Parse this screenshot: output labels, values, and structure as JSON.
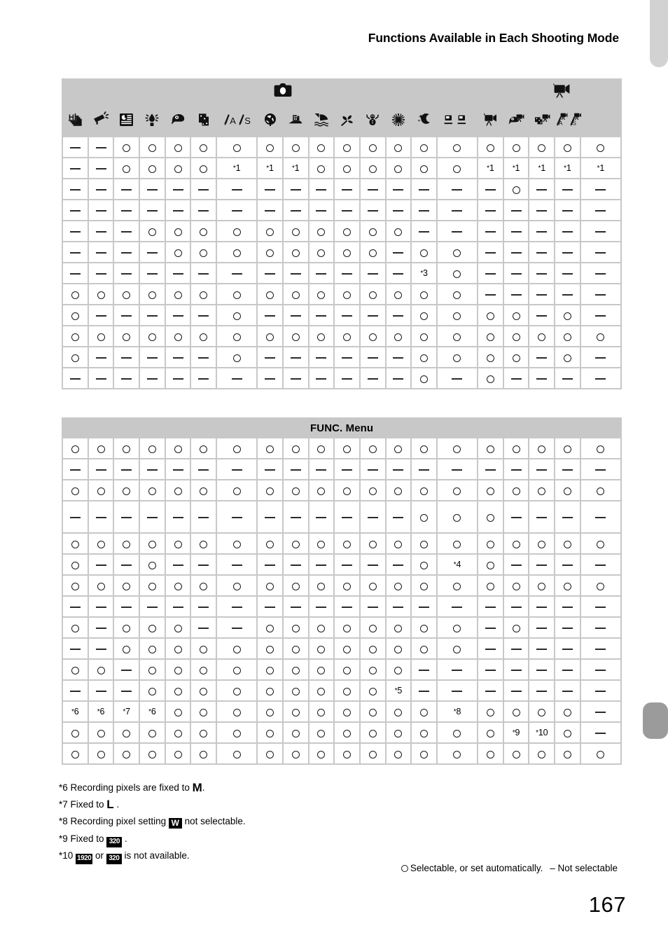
{
  "page": {
    "title": "Functions Available in Each Shooting Mode",
    "number": "167"
  },
  "colors": {
    "grid": "#c8c8c8",
    "header_bg": "#c8c8c8",
    "cell_bg": "#ffffff",
    "ink": "#1a1a1a",
    "tab_light": "#d2d2d2",
    "tab_current": "#9b9b9b"
  },
  "groups": [
    {
      "label": "still-camera-icon",
      "icon": "camera",
      "span": 16
    },
    {
      "label": "movie-camera-icon",
      "icon": "movie",
      "span": 4
    }
  ],
  "mode_columns": [
    {
      "icon": "high-speed-burst",
      "wide": false
    },
    {
      "icon": "best-image-selection",
      "wide": false
    },
    {
      "icon": "handheld-nightscene",
      "wide": false
    },
    {
      "icon": "low-light",
      "wide": false
    },
    {
      "icon": "fish-eye-effect",
      "wide": false
    },
    {
      "icon": "miniature-effect",
      "wide": false
    },
    {
      "icon": "creative-filters-as",
      "wide": true
    },
    {
      "icon": "monochrome",
      "wide": false
    },
    {
      "icon": "poster-effect",
      "wide": false
    },
    {
      "icon": "beach",
      "wide": false
    },
    {
      "icon": "foliage",
      "wide": false
    },
    {
      "icon": "snow",
      "wide": false
    },
    {
      "icon": "fireworks",
      "wide": false
    },
    {
      "icon": "long-shutter",
      "wide": false
    },
    {
      "icon": "stitch-assist",
      "wide": true
    },
    {
      "icon": "movie-standard",
      "wide": false
    },
    {
      "icon": "movie-fish-eye",
      "wide": false
    },
    {
      "icon": "movie-miniature",
      "wide": false
    },
    {
      "icon": "movie-creative-as",
      "wide": true
    }
  ],
  "section_label": "FUNC. Menu",
  "marks": {
    "available": "O",
    "unavailable": "–"
  },
  "table_top": {
    "rows": [
      {
        "cells": [
          "-",
          "-",
          "o",
          "o",
          "o",
          "o",
          "o",
          "o",
          "o",
          "o",
          "o",
          "o",
          "o",
          "o",
          "o",
          "o",
          "o",
          "o",
          "o",
          "o"
        ]
      },
      {
        "cells": [
          "-",
          "-",
          "o",
          "o",
          "o",
          "o",
          "*1",
          "*1",
          "*1",
          "o",
          "o",
          "o",
          "o",
          "o",
          "o",
          "*1",
          "*1",
          "*1",
          "*1",
          "*1"
        ]
      },
      {
        "cells": [
          "-",
          "-",
          "-",
          "-",
          "-",
          "-",
          "-",
          "-",
          "-",
          "-",
          "-",
          "-",
          "-",
          "-",
          "-",
          "-",
          "o",
          "-",
          "-",
          "-"
        ]
      },
      {
        "cells": [
          "-",
          "-",
          "-",
          "-",
          "-",
          "-",
          "-",
          "-",
          "-",
          "-",
          "-",
          "-",
          "-",
          "-",
          "-",
          "-",
          "-",
          "-",
          "-",
          "-"
        ]
      },
      {
        "cells": [
          "-",
          "-",
          "-",
          "o",
          "o",
          "o",
          "o",
          "o",
          "o",
          "o",
          "o",
          "o",
          "o",
          "-",
          "-",
          "-",
          "-",
          "-",
          "-",
          "-"
        ]
      },
      {
        "cells": [
          "-",
          "-",
          "-",
          "-",
          "o",
          "o",
          "o",
          "o",
          "o",
          "o",
          "o",
          "o",
          "-",
          "o",
          "o",
          "-",
          "-",
          "-",
          "-",
          "-"
        ]
      },
      {
        "cells": [
          "-",
          "-",
          "-",
          "-",
          "-",
          "-",
          "-",
          "-",
          "-",
          "-",
          "-",
          "-",
          "-",
          "*3",
          "o",
          "-",
          "-",
          "-",
          "-",
          "-"
        ]
      },
      {
        "cells": [
          "o",
          "o",
          "o",
          "o",
          "o",
          "o",
          "o",
          "o",
          "o",
          "o",
          "o",
          "o",
          "o",
          "o",
          "o",
          "-",
          "-",
          "-",
          "-",
          "-"
        ]
      },
      {
        "cells": [
          "o",
          "-",
          "-",
          "-",
          "-",
          "-",
          "o",
          "-",
          "-",
          "-",
          "-",
          "-",
          "-",
          "o",
          "o",
          "o",
          "o",
          "-",
          "o"
        ]
      },
      {
        "cells": [
          "o",
          "o",
          "o",
          "o",
          "o",
          "o",
          "o",
          "o",
          "o",
          "o",
          "o",
          "o",
          "o",
          "o",
          "o",
          "o",
          "o",
          "o",
          "o",
          "o"
        ]
      },
      {
        "cells": [
          "o",
          "-",
          "-",
          "-",
          "-",
          "-",
          "o",
          "-",
          "-",
          "-",
          "-",
          "-",
          "-",
          "o",
          "o",
          "o",
          "o",
          "-",
          "o"
        ]
      },
      {
        "cells": [
          "-",
          "-",
          "-",
          "-",
          "-",
          "-",
          "-",
          "-",
          "-",
          "-",
          "-",
          "-",
          "-",
          "o",
          "-",
          "o",
          "-",
          "-",
          "-",
          "-"
        ]
      }
    ]
  },
  "table_func": {
    "rows": [
      {
        "tall": false,
        "cells": [
          "o",
          "o",
          "o",
          "o",
          "o",
          "o",
          "o",
          "o",
          "o",
          "o",
          "o",
          "o",
          "o",
          "o",
          "o",
          "o",
          "o",
          "o",
          "o",
          "o"
        ]
      },
      {
        "tall": false,
        "cells": [
          "-",
          "-",
          "-",
          "-",
          "-",
          "-",
          "-",
          "-",
          "-",
          "-",
          "-",
          "-",
          "-",
          "-",
          "-",
          "-",
          "-",
          "-",
          "-",
          "-"
        ]
      },
      {
        "tall": false,
        "cells": [
          "o",
          "o",
          "o",
          "o",
          "o",
          "o",
          "o",
          "o",
          "o",
          "o",
          "o",
          "o",
          "o",
          "o",
          "o",
          "o",
          "o",
          "o",
          "o",
          "o"
        ]
      },
      {
        "tall": true,
        "cells": [
          "-",
          "-",
          "-",
          "-",
          "-",
          "-",
          "-",
          "-",
          "-",
          "-",
          "-",
          "-",
          "-",
          "o",
          "o",
          "o",
          "-",
          "-",
          "-",
          "-"
        ]
      },
      {
        "tall": false,
        "cells": [
          "o",
          "o",
          "o",
          "o",
          "o",
          "o",
          "o",
          "o",
          "o",
          "o",
          "o",
          "o",
          "o",
          "o",
          "o",
          "o",
          "o",
          "o",
          "o",
          "o"
        ]
      },
      {
        "tall": false,
        "cells": [
          "o",
          "-",
          "-",
          "o",
          "-",
          "-",
          "-",
          "-",
          "-",
          "-",
          "-",
          "-",
          "-",
          "o",
          "*4",
          "o",
          "-",
          "-",
          "-",
          "-"
        ]
      },
      {
        "tall": false,
        "cells": [
          "o",
          "o",
          "o",
          "o",
          "o",
          "o",
          "o",
          "o",
          "o",
          "o",
          "o",
          "o",
          "o",
          "o",
          "o",
          "o",
          "o",
          "o",
          "o",
          "o"
        ]
      },
      {
        "tall": false,
        "cells": [
          "-",
          "-",
          "-",
          "-",
          "-",
          "-",
          "-",
          "-",
          "-",
          "-",
          "-",
          "-",
          "-",
          "-",
          "-",
          "-",
          "-",
          "-",
          "-",
          "-"
        ]
      },
      {
        "tall": false,
        "cells": [
          "o",
          "-",
          "o",
          "o",
          "o",
          "-",
          "-",
          "o",
          "o",
          "o",
          "o",
          "o",
          "o",
          "o",
          "o",
          "-",
          "o",
          "-",
          "-",
          "-",
          "-"
        ]
      },
      {
        "tall": false,
        "cells": [
          "-",
          "-",
          "o",
          "o",
          "o",
          "o",
          "o",
          "o",
          "o",
          "o",
          "o",
          "o",
          "o",
          "o",
          "o",
          "-",
          "-",
          "-",
          "-",
          "-"
        ]
      },
      {
        "tall": false,
        "cells": [
          "o",
          "o",
          "-",
          "o",
          "o",
          "o",
          "o",
          "o",
          "o",
          "o",
          "o",
          "o",
          "o",
          "-",
          "-",
          "-",
          "-",
          "-",
          "-",
          "-"
        ]
      },
      {
        "tall": false,
        "cells": [
          "-",
          "-",
          "-",
          "o",
          "o",
          "o",
          "o",
          "o",
          "o",
          "o",
          "o",
          "o",
          "*5",
          "-",
          "-",
          "-",
          "-",
          "-",
          "-",
          "-"
        ]
      },
      {
        "tall": false,
        "cells": [
          "*6",
          "*6",
          "*7",
          "*6",
          "o",
          "o",
          "o",
          "o",
          "o",
          "o",
          "o",
          "o",
          "o",
          "o",
          "*8",
          "o",
          "o",
          "o",
          "o"
        ]
      },
      {
        "tall": false,
        "cells": [
          "o",
          "o",
          "o",
          "o",
          "o",
          "o",
          "o",
          "o",
          "o",
          "o",
          "o",
          "o",
          "o",
          "o",
          "o",
          "o",
          "*9",
          "*10",
          "o"
        ]
      },
      {
        "tall": false,
        "cells": [
          "o",
          "o",
          "o",
          "o",
          "o",
          "o",
          "o",
          "o",
          "o",
          "o",
          "o",
          "o",
          "o",
          "o",
          "o",
          "o",
          "o",
          "o",
          "o",
          "o"
        ]
      }
    ]
  },
  "footnotes": [
    {
      "id": "*6",
      "text_before": "Recording pixels are fixed to ",
      "glyph": "M",
      "glyph_kind": "plain",
      "text_after": "."
    },
    {
      "id": "*7",
      "text_before": "Fixed to ",
      "glyph": "L",
      "glyph_kind": "plain",
      "text_after": " ."
    },
    {
      "id": "*8",
      "text_before": "Recording pixel setting ",
      "glyph": "W",
      "glyph_kind": "boxed-w",
      "text_after": " not selectable."
    },
    {
      "id": "*9",
      "text_before": "Fixed to ",
      "glyph": "320",
      "glyph_kind": "boxed-px",
      "text_after": " ."
    },
    {
      "id": "*10",
      "text_before": " ",
      "glyph": "1920",
      "glyph_kind": "boxed-px",
      "text_middle": " or ",
      "glyph2": "320",
      "glyph2_kind": "boxed-px",
      "text_after": " is not available."
    }
  ],
  "legend": {
    "available_text": "Selectable, or set automatically.",
    "unavailable_text": "– Not selectable"
  }
}
